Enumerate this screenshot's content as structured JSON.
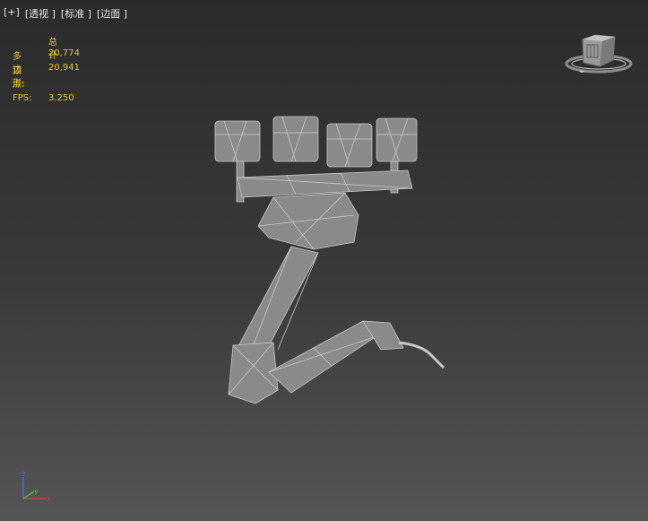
{
  "viewport": {
    "menu": {
      "plus": "[+]",
      "view": "[透视 ]",
      "shading": "[标准 ]",
      "edges": "[边面 ]"
    },
    "stats": {
      "header": "总计",
      "polygons_label": "多边形:",
      "polygons_value": "20,774",
      "vertices_label": "顶点:",
      "vertices_value": "20,941",
      "fps_label": "FPS:",
      "fps_value": "3.250"
    },
    "axis": {
      "z": "z",
      "x": "x",
      "y": "y"
    }
  },
  "colors": {
    "stats_text": "#e8c437",
    "model_fill": "#8a8a8a",
    "model_edge": "#c8c8c8",
    "axis_z": "#3a6fe0",
    "axis_x": "#d23c3c",
    "axis_y": "#3fbf3f"
  },
  "icons": [
    "viewcube-icon",
    "axis-tripod-icon"
  ]
}
